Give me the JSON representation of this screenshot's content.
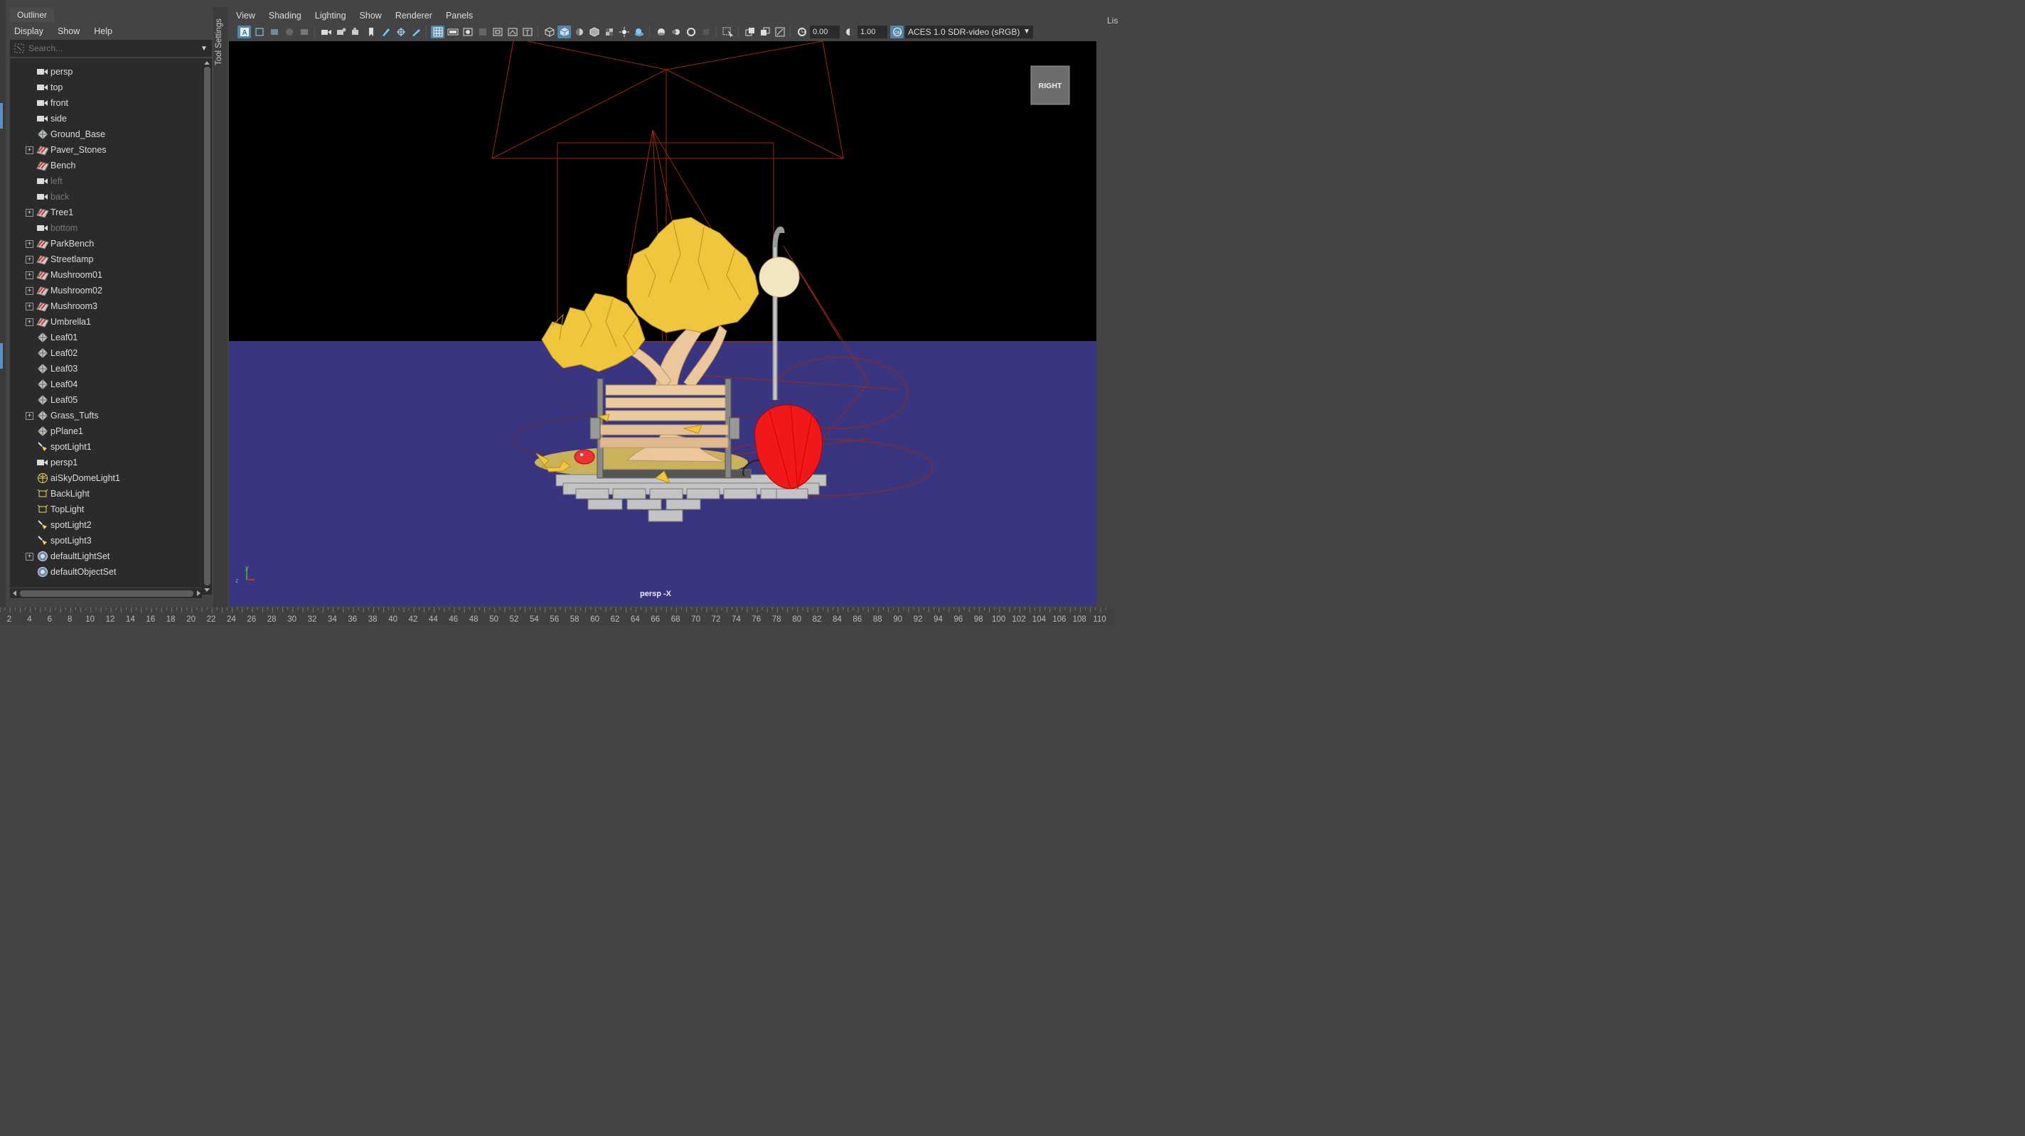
{
  "outliner": {
    "tab_label": "Outliner",
    "menu": [
      "Display",
      "Show",
      "Help"
    ],
    "search_placeholder": "Search...",
    "items": [
      {
        "label": "persp",
        "icon": "camera-icon",
        "expand": false,
        "dim": false
      },
      {
        "label": "top",
        "icon": "camera-icon",
        "expand": false,
        "dim": false
      },
      {
        "label": "front",
        "icon": "camera-icon",
        "expand": false,
        "dim": false
      },
      {
        "label": "side",
        "icon": "camera-icon",
        "expand": false,
        "dim": false
      },
      {
        "label": "Ground_Base",
        "icon": "mesh-icon",
        "expand": false,
        "dim": false
      },
      {
        "label": "Paver_Stones",
        "icon": "group-icon",
        "expand": true,
        "dim": false
      },
      {
        "label": "Bench",
        "icon": "group-icon",
        "expand": false,
        "dim": false
      },
      {
        "label": "left",
        "icon": "camera-icon",
        "expand": false,
        "dim": true
      },
      {
        "label": "back",
        "icon": "camera-icon",
        "expand": false,
        "dim": true
      },
      {
        "label": "Tree1",
        "icon": "group-icon",
        "expand": true,
        "dim": false
      },
      {
        "label": "bottom",
        "icon": "camera-icon",
        "expand": false,
        "dim": true
      },
      {
        "label": "ParkBench",
        "icon": "group-icon",
        "expand": true,
        "dim": false
      },
      {
        "label": "Streetlamp",
        "icon": "group-icon",
        "expand": true,
        "dim": false
      },
      {
        "label": "Mushroom01",
        "icon": "group-icon",
        "expand": true,
        "dim": false
      },
      {
        "label": "Mushroom02",
        "icon": "group-icon",
        "expand": true,
        "dim": false
      },
      {
        "label": "Mushroom3",
        "icon": "group-icon",
        "expand": true,
        "dim": false
      },
      {
        "label": "Umbrella1",
        "icon": "group-icon",
        "expand": true,
        "dim": false
      },
      {
        "label": "Leaf01",
        "icon": "mesh-icon",
        "expand": false,
        "dim": false
      },
      {
        "label": "Leaf02",
        "icon": "mesh-icon",
        "expand": false,
        "dim": false
      },
      {
        "label": "Leaf03",
        "icon": "mesh-icon",
        "expand": false,
        "dim": false
      },
      {
        "label": "Leaf04",
        "icon": "mesh-icon",
        "expand": false,
        "dim": false
      },
      {
        "label": "Leaf05",
        "icon": "mesh-icon",
        "expand": false,
        "dim": false
      },
      {
        "label": "Grass_Tufts",
        "icon": "mesh-icon",
        "expand": true,
        "dim": false
      },
      {
        "label": "pPlane1",
        "icon": "mesh-icon",
        "expand": false,
        "dim": false
      },
      {
        "label": "spotLight1",
        "icon": "spotlight-icon",
        "expand": false,
        "dim": false
      },
      {
        "label": "persp1",
        "icon": "camera-icon",
        "expand": false,
        "dim": false
      },
      {
        "label": "aiSkyDomeLight1",
        "icon": "skydome-icon",
        "expand": false,
        "dim": false
      },
      {
        "label": "BackLight",
        "icon": "arealight-icon",
        "expand": false,
        "dim": false
      },
      {
        "label": "TopLight",
        "icon": "arealight-icon",
        "expand": false,
        "dim": false
      },
      {
        "label": "spotLight2",
        "icon": "spotlight-icon",
        "expand": false,
        "dim": false
      },
      {
        "label": "spotLight3",
        "icon": "spotlight-icon",
        "expand": false,
        "dim": false
      },
      {
        "label": "defaultLightSet",
        "icon": "set-icon",
        "expand": true,
        "dim": false
      },
      {
        "label": "defaultObjectSet",
        "icon": "set-icon",
        "expand": false,
        "dim": false
      }
    ]
  },
  "tool_settings_label": "Tool Settings",
  "viewport_panel": {
    "menu": [
      "View",
      "Shading",
      "Lighting",
      "Show",
      "Renderer",
      "Panels"
    ],
    "exposure_value": "0.00",
    "gamma_value": "1.00",
    "color_space": "ACES 1.0 SDR-video (sRGB)",
    "camera_label": "persp -X",
    "viewcube_label": "RIGHT",
    "axis_x": "z",
    "axis_y": "y"
  },
  "right_panel_label": "Lis",
  "timeline": {
    "frames": [
      "2",
      "4",
      "6",
      "8",
      "10",
      "12",
      "14",
      "16",
      "18",
      "20",
      "22",
      "24",
      "26",
      "28",
      "30",
      "32",
      "34",
      "36",
      "38",
      "40",
      "42",
      "44",
      "46",
      "48",
      "50",
      "52",
      "54",
      "56",
      "58",
      "60",
      "62",
      "64",
      "66",
      "68",
      "70",
      "72",
      "74",
      "76",
      "78",
      "80",
      "82",
      "84",
      "86",
      "88",
      "90",
      "92",
      "94",
      "96",
      "98",
      "100",
      "102",
      "104",
      "106",
      "108",
      "110"
    ]
  },
  "colors": {
    "sky": "#000000",
    "ground": "#3a3581",
    "ui_bg": "#444444",
    "field_bg": "#2b2b2b",
    "accent": "#5285a6",
    "light_wire": "#9a2a12",
    "foliage": "#f0c63c",
    "umbrella": "#e81010"
  }
}
